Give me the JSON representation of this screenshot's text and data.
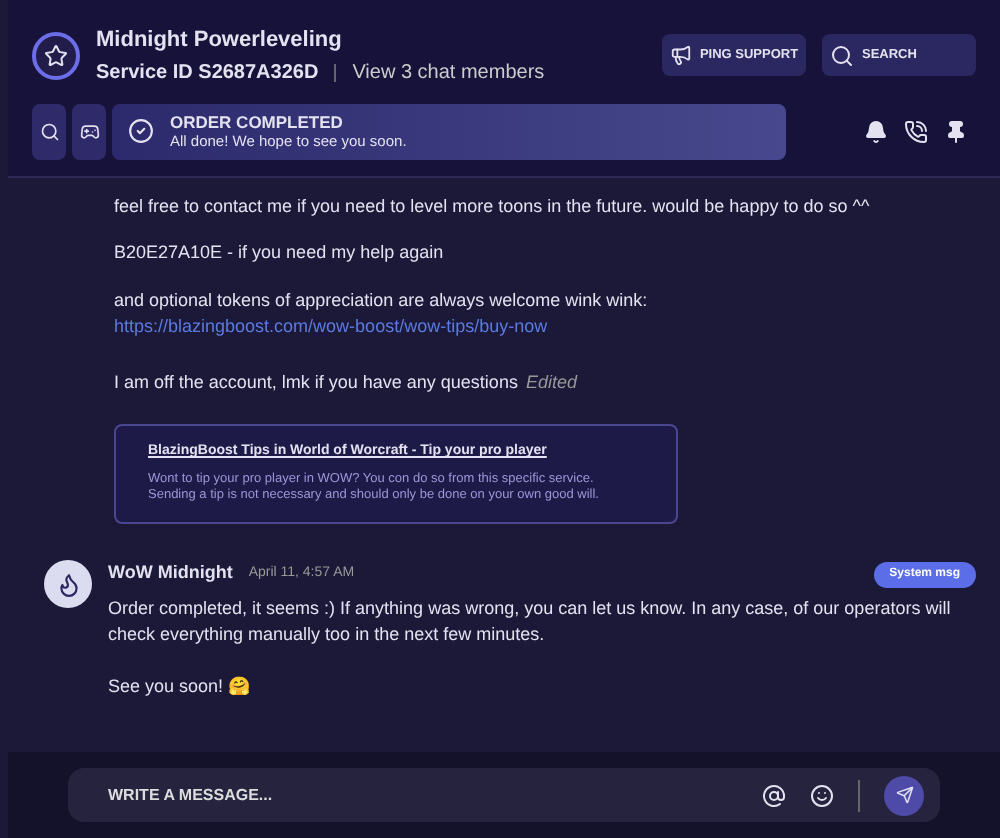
{
  "header": {
    "title": "Midnight Powerleveling",
    "service_id": "Service ID S2687A326D",
    "members_link": "View 3 chat members",
    "buttons": [
      {
        "kind": "ping",
        "label": "PING SUPPORT"
      },
      {
        "kind": "search",
        "label": "SEARCH"
      }
    ]
  },
  "status_banner": {
    "title": "ORDER COMPLETED",
    "subtitle": "All done! We hope to see you soon."
  },
  "messages": [
    {
      "kind": "text",
      "text": "feel free to contact me if you need to level more toons in the future. would be happy to do so ^^"
    },
    {
      "kind": "text",
      "text": "B20E27A10E - if you need my help again"
    },
    {
      "kind": "text_link",
      "text": "and optional tokens of appreciation are always welcome wink wink:",
      "link": "https://blazingboost.com/wow-boost/wow-tips/buy-now"
    },
    {
      "kind": "edited",
      "text": "I am off the account, lmk if you have any questions",
      "note": "Edited"
    },
    {
      "kind": "card",
      "title": "BlazingBoost Tips in World of Worcraft - Tip your pro player",
      "text": "Wont to tip your pro player in WOW? You con do so from this specific service. Sending a tip is not necessary and should only be done on your own good will."
    }
  ],
  "system_message": {
    "author": "WoW Midnight",
    "time": "April 11, 4:57 AM",
    "badge": "System msg",
    "paragraphs": [
      "Order completed, it seems :) If anything was wrong, you can let us know. In any case, of our operators will check everything manually too in the next few minutes.",
      "See you soon! 🤗"
    ]
  },
  "composer": {
    "placeholder": "WRITE A MESSAGE..."
  }
}
